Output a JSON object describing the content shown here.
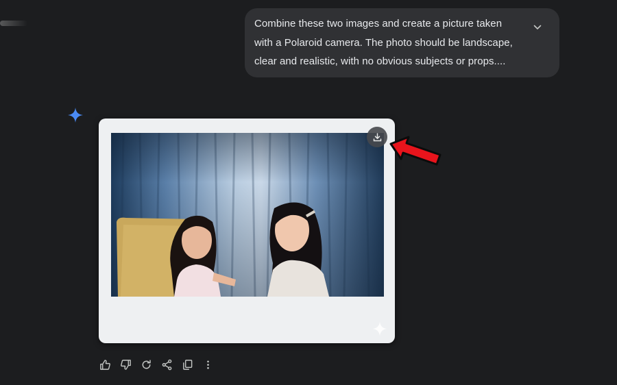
{
  "prompt": {
    "lines": [
      "Combine these two images and create a picture taken",
      "with a Polaroid camera. The photo should be landscape,",
      "clear and realistic, with no obvious subjects or props...."
    ],
    "expand_icon": "chevron-down-icon"
  },
  "response": {
    "avatar_icon": "gemini-sparkle-icon",
    "image": {
      "description_icon": "polaroid-photo",
      "download_icon": "download-icon",
      "watermark_icon": "sparkle-watermark-icon"
    },
    "annotation_icon": "red-arrow-icon"
  },
  "actions": [
    {
      "name": "thumbs-up-icon"
    },
    {
      "name": "thumbs-down-icon"
    },
    {
      "name": "regenerate-icon"
    },
    {
      "name": "share-icon"
    },
    {
      "name": "copy-icon"
    },
    {
      "name": "more-options-icon"
    }
  ],
  "colors": {
    "background": "#1c1d1f",
    "bubble": "#303134",
    "accent_blue": "#4a8af4",
    "arrow_red": "#e8141c"
  }
}
